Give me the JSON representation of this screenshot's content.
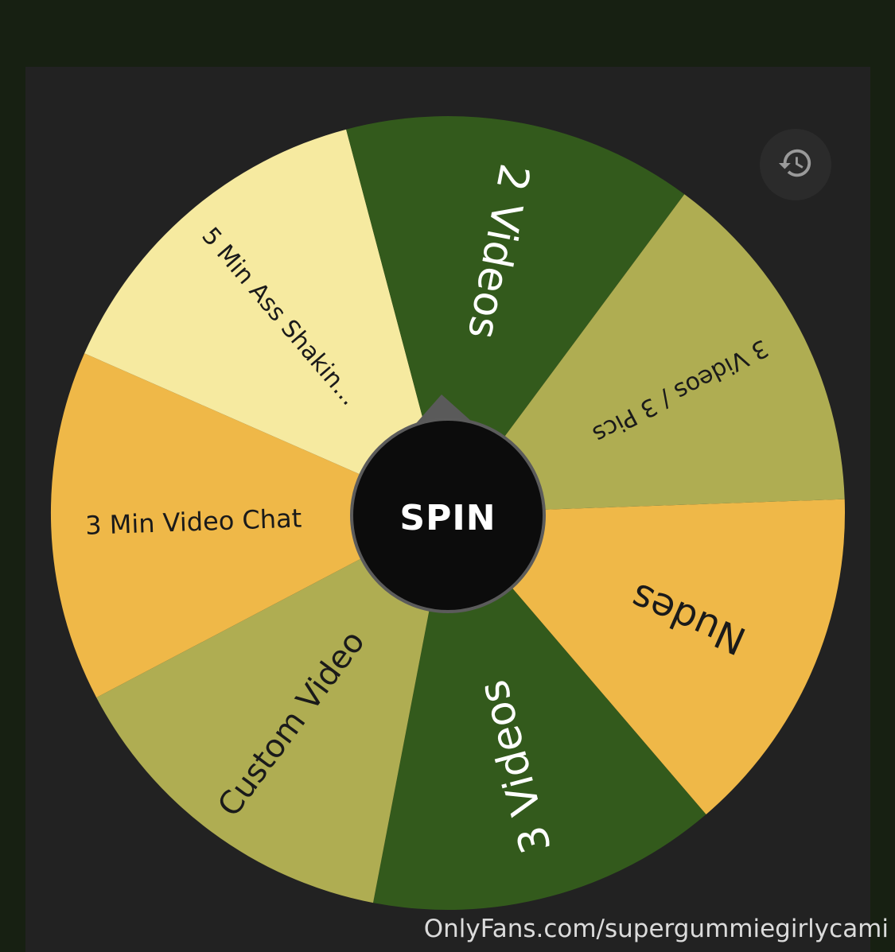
{
  "wheel": {
    "segments": [
      {
        "label": "Nudes",
        "color": "#efb848",
        "text_color": "#1a1a1a"
      },
      {
        "label": "3 Videos",
        "color": "#335a1c",
        "text_color": "#ffffff"
      },
      {
        "label": "Custom Video",
        "color": "#afad52",
        "text_color": "#1a1a1a"
      },
      {
        "label": "3 Min Video Chat",
        "color": "#efb848",
        "text_color": "#1a1a1a"
      },
      {
        "label": "5 Min Ass Shakin...",
        "color": "#f6eaa0",
        "text_color": "#1a1a1a"
      },
      {
        "label": "2 Videos",
        "color": "#335a1c",
        "text_color": "#ffffff"
      },
      {
        "label": "3 Videos / 3 Pics",
        "color": "#afad52",
        "text_color": "#1a1a1a"
      }
    ],
    "pointer_color": "#5a5a5a"
  },
  "spin_button": {
    "label": "SPIN"
  },
  "history_button": {
    "icon": "history-icon"
  },
  "watermark": "OnlyFans.com/supergummiegirlycami"
}
